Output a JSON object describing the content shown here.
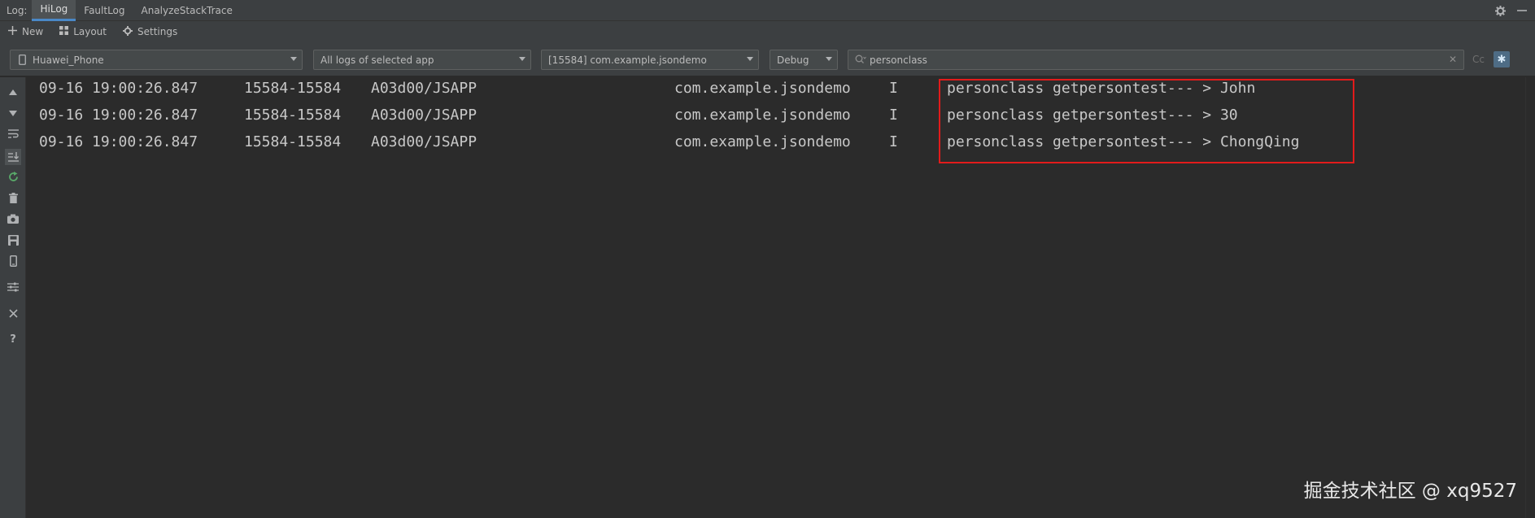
{
  "tabbar": {
    "log_label": "Log:",
    "tabs": [
      {
        "label": "HiLog",
        "active": true
      },
      {
        "label": "FaultLog",
        "active": false
      },
      {
        "label": "AnalyzeStackTrace",
        "active": false
      }
    ],
    "icons": [
      "gear-icon",
      "minimize-icon"
    ]
  },
  "toolbar": {
    "new_label": "New",
    "layout_label": "Layout",
    "settings_label": "Settings"
  },
  "filters": {
    "device": "Huawei_Phone",
    "scope": "All logs of selected app",
    "process": "[15584] com.example.jsondemo",
    "level": "Debug",
    "search_value": "personclass",
    "case_label": "Cc",
    "regex_icon": "regex-icon"
  },
  "sidebar": {
    "icons": [
      "arrow-up-icon",
      "arrow-down-icon",
      "soft-wrap-icon",
      "scroll-to-end-icon",
      "restart-icon",
      "trash-icon",
      "camera-icon",
      "save-icon",
      "device-icon",
      "filter-settings-icon",
      "close-icon",
      "help-icon"
    ]
  },
  "logs": [
    {
      "time": "09-16 19:00:26.847",
      "pid": "15584-15584",
      "tag": "A03d00/JSAPP",
      "package": "com.example.jsondemo",
      "level": "I",
      "message": "personclass getpersontest--- > John"
    },
    {
      "time": "09-16 19:00:26.847",
      "pid": "15584-15584",
      "tag": "A03d00/JSAPP",
      "package": "com.example.jsondemo",
      "level": "I",
      "message": "personclass getpersontest--- > 30"
    },
    {
      "time": "09-16 19:00:26.847",
      "pid": "15584-15584",
      "tag": "A03d00/JSAPP",
      "package": "com.example.jsondemo",
      "level": "I",
      "message": "personclass getpersontest--- > ChongQing"
    }
  ],
  "colors": {
    "background": "#2b2b2b",
    "panel": "#3c3f41",
    "highlight_border": "#e21b1b",
    "active_tab_underline": "#4a88c7"
  },
  "watermark": "掘金技术社区 @ xq9527"
}
